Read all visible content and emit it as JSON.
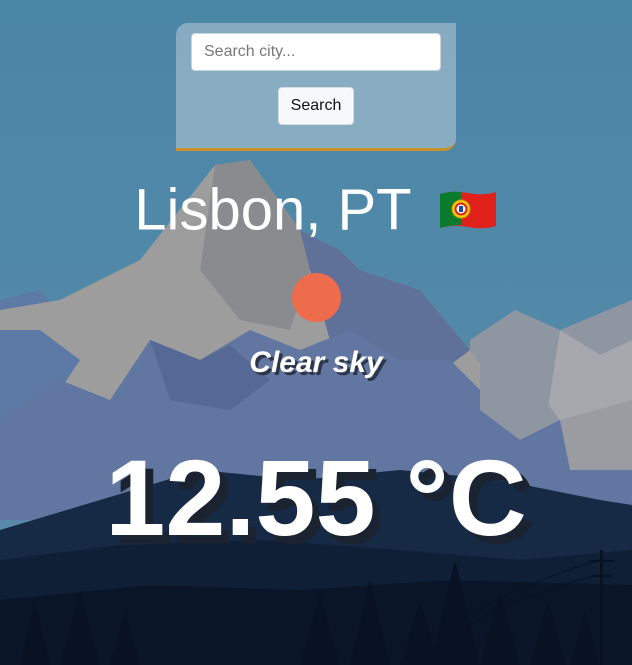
{
  "search": {
    "placeholder": "Search city...",
    "value": "",
    "button_label": "Search"
  },
  "location": {
    "label": "Lisbon, PT",
    "flag_icon": "portugal-flag-icon"
  },
  "weather": {
    "icon": "sun-icon",
    "icon_color": "#ec6c4b",
    "description": "Clear sky",
    "temperature": "12.55 °C"
  },
  "colors": {
    "accent_border": "#c8912a"
  }
}
